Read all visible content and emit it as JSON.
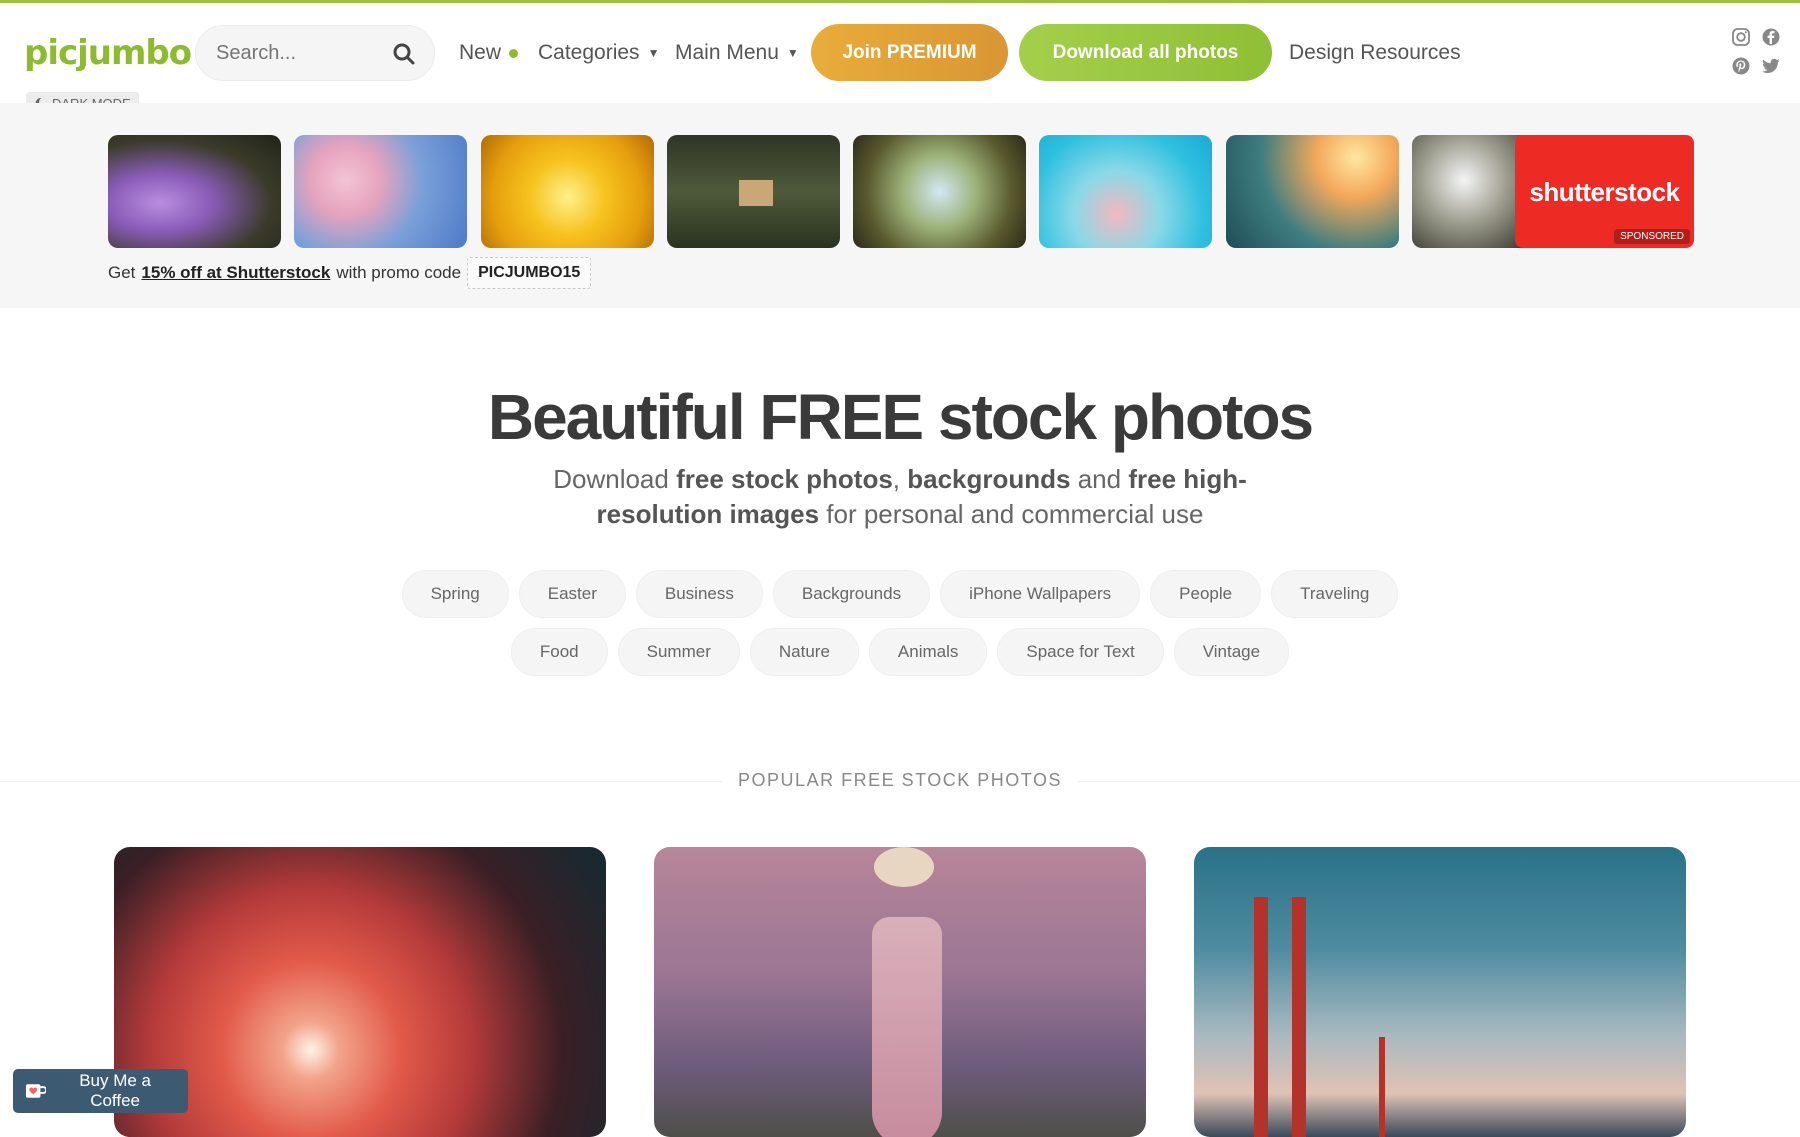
{
  "header": {
    "logo": "picjumbo",
    "search_placeholder": "Search...",
    "nav_new": "New",
    "nav_categories": "Categories",
    "nav_main_menu": "Main Menu",
    "btn_premium": "Join PREMIUM",
    "btn_download": "Download all photos",
    "nav_design": "Design Resources",
    "dark_mode": "DARK MODE",
    "social_icons": [
      "instagram-icon",
      "facebook-icon",
      "pinterest-icon",
      "twitter-icon"
    ]
  },
  "strip": {
    "thumbnails": [
      "purple crocus flowers",
      "pink cherry blossoms",
      "yellow flowers",
      "birdhouse in park",
      "tree buds",
      "pink flowers sky",
      "blossoms at sunset",
      "white blossoms"
    ],
    "sponsor_logo": "shutterstock",
    "sponsored_label": "SPONSORED",
    "promo_prefix": "Get",
    "promo_link": "15% off at Shutterstock",
    "promo_mid": "with promo code",
    "promo_code": "PICJUMBO15"
  },
  "hero": {
    "title": "Beautiful FREE stock photos",
    "sub_1": "Download ",
    "sub_b1": "free stock photos",
    "sub_2": ", ",
    "sub_b2": "backgrounds",
    "sub_3": " and ",
    "sub_b3": "free high-resolution images",
    "sub_4": " for personal and commercial use"
  },
  "tags_row1": [
    "Spring",
    "Easter",
    "Business",
    "Backgrounds",
    "iPhone Wallpapers",
    "People",
    "Traveling"
  ],
  "tags_row2": [
    "Food",
    "Summer",
    "Nature",
    "Animals",
    "Space for Text",
    "Vintage"
  ],
  "popular_heading": "POPULAR FREE STOCK PHOTOS",
  "cards": [
    "fireworks at night",
    "woman in lavender field",
    "Golden Gate Bridge"
  ],
  "bmc_label": "Buy Me a Coffee",
  "colors": {
    "brand_green": "#8dbb2f",
    "premium_orange": "#e8ad3a",
    "shutterstock_red": "#ee2a24",
    "bmc_blue": "#3d5a73"
  }
}
